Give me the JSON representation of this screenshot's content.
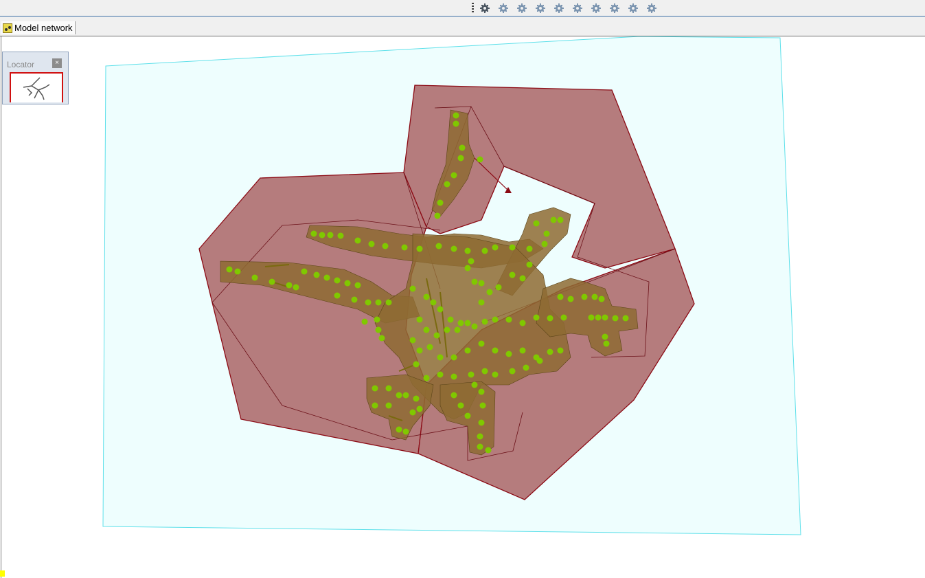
{
  "toolbar": {
    "buttons": [
      {
        "icon": "gear-icon"
      },
      {
        "icon": "gear-icon"
      },
      {
        "icon": "gear-icon"
      },
      {
        "icon": "gear-icon"
      },
      {
        "icon": "gear-icon"
      },
      {
        "icon": "gear-icon"
      },
      {
        "icon": "gear-icon"
      },
      {
        "icon": "gear-icon"
      },
      {
        "icon": "gear-icon"
      },
      {
        "icon": "gear-icon"
      }
    ]
  },
  "tab": {
    "label": "Model network",
    "icon": "network-model-icon"
  },
  "locator": {
    "title": "Locator",
    "close_label": "×"
  },
  "map": {
    "colors": {
      "boundary_fill": "#eefefe",
      "boundary_stroke": "#5ee0ea",
      "catchment_fill": "#b57c7d",
      "catchment_stroke": "#8b0a14",
      "subcatchment_fill": "#8e6b32",
      "node_color": "#80c800",
      "canvas_bg": "#ffffff"
    }
  }
}
